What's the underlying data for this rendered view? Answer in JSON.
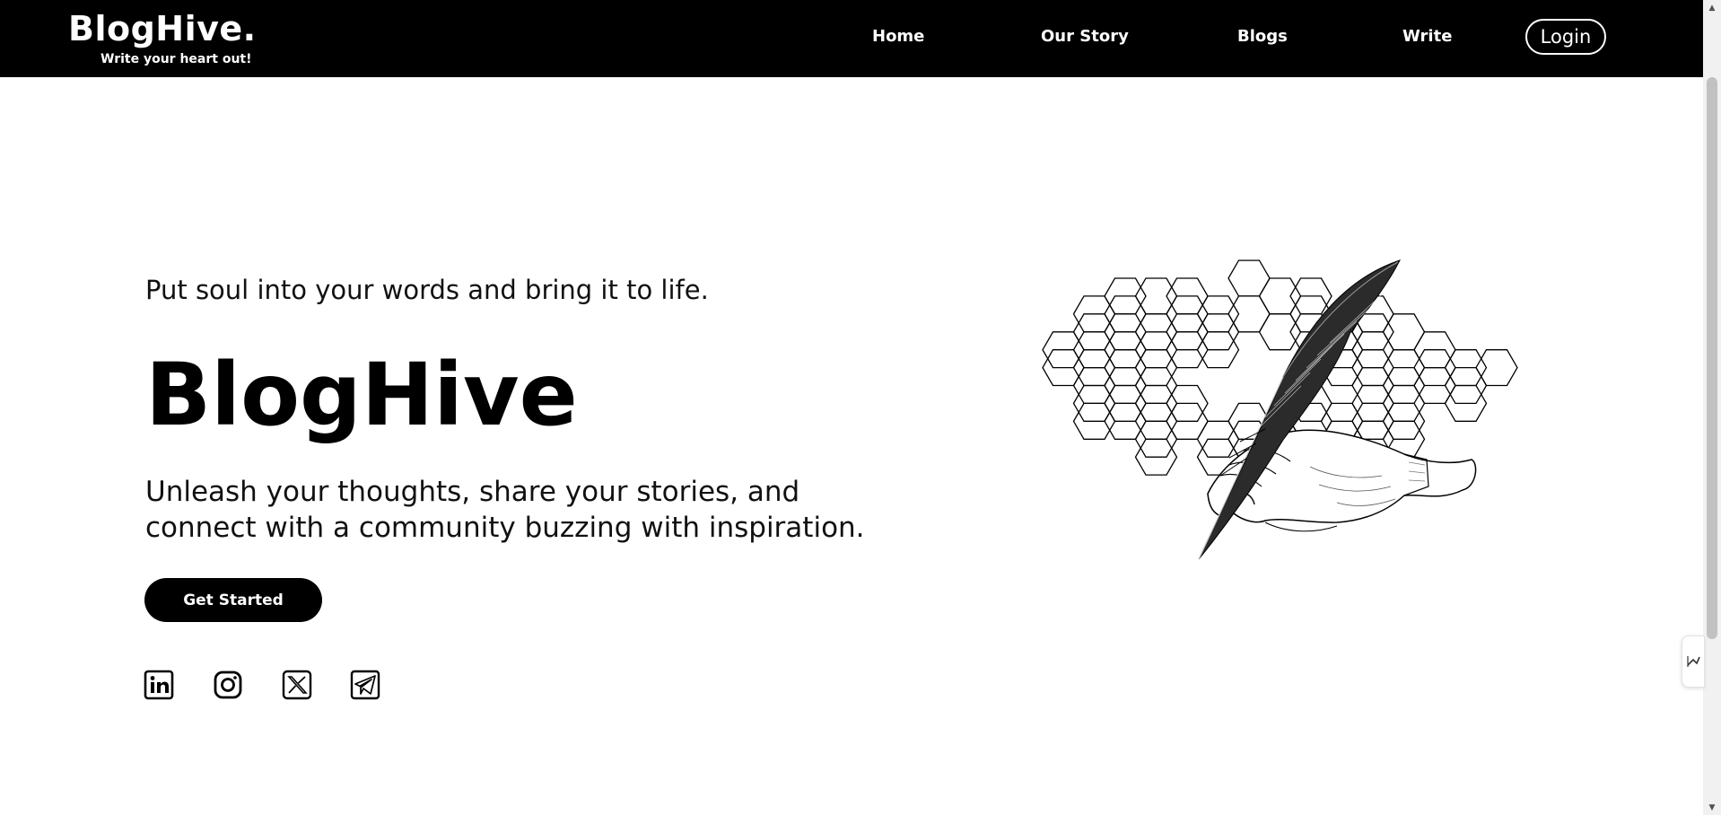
{
  "brand": {
    "name": "BlogHive.",
    "tagline": "Write your heart out!"
  },
  "nav": {
    "links": [
      "Home",
      "Our Story",
      "Blogs",
      "Write"
    ],
    "login_label": "Login"
  },
  "hero": {
    "tagline": "Put soul into your words and bring it to life.",
    "title": "BlogHive",
    "description": "Unleash your thoughts, share your stories, and connect with a community buzzing with inspiration.",
    "cta_label": "Get Started"
  },
  "social": {
    "icons": [
      "linkedin-icon",
      "instagram-icon",
      "x-icon",
      "telegram-icon"
    ]
  },
  "illustration": {
    "subject": "hand-holding-quill-over-honeycomb"
  },
  "colors": {
    "navbar_bg": "#000000",
    "page_bg": "#ffffff",
    "primary": "#000000",
    "text_light": "#ffffff"
  }
}
